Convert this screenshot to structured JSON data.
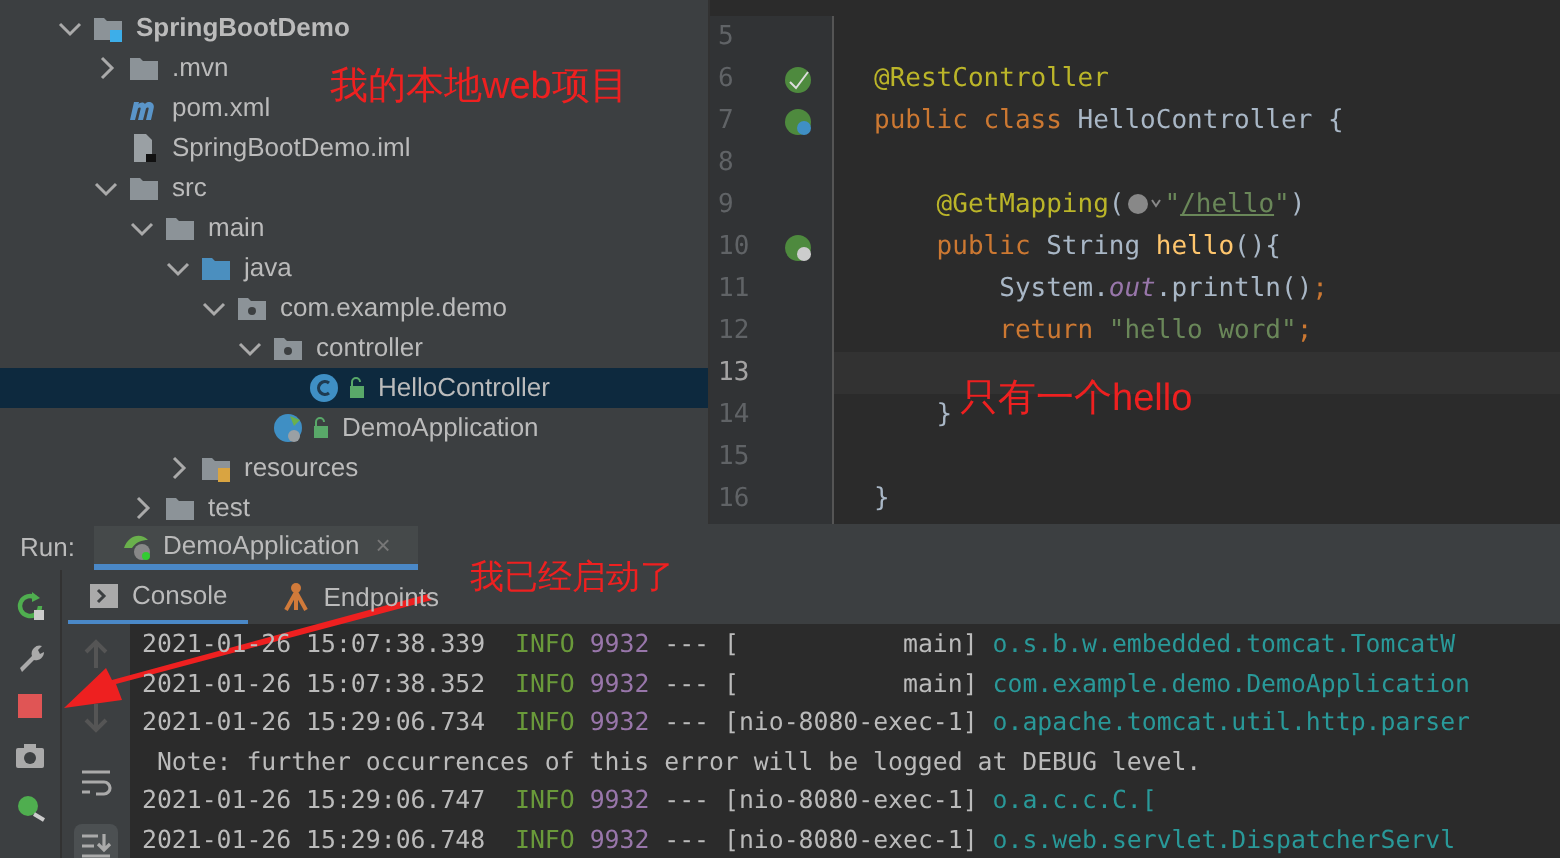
{
  "project_tree": [
    {
      "label": "SpringBootDemo",
      "kind": "module",
      "expanded": true,
      "selected": false,
      "children": [
        {
          "label": ".mvn",
          "kind": "folder",
          "expanded": false,
          "selected": false
        },
        {
          "label": "pom.xml",
          "kind": "maven",
          "selected": false
        },
        {
          "label": "SpringBootDemo.iml",
          "kind": "iml",
          "selected": false
        },
        {
          "label": "src",
          "kind": "folder",
          "expanded": true,
          "selected": false,
          "children": [
            {
              "label": "main",
              "kind": "folder",
              "expanded": true,
              "selected": false,
              "children": [
                {
                  "label": "java",
                  "kind": "source",
                  "expanded": true,
                  "selected": false,
                  "children": [
                    {
                      "label": "com.example.demo",
                      "kind": "package",
                      "expanded": true,
                      "selected": false,
                      "children": [
                        {
                          "label": "controller",
                          "kind": "package",
                          "expanded": true,
                          "selected": false,
                          "children": [
                            {
                              "label": "HelloController",
                              "kind": "class",
                              "selected": true
                            }
                          ]
                        },
                        {
                          "label": "DemoApplication",
                          "kind": "app",
                          "selected": false
                        }
                      ]
                    }
                  ]
                },
                {
                  "label": "resources",
                  "kind": "resources",
                  "expanded": false,
                  "selected": false
                }
              ]
            },
            {
              "label": "test",
              "kind": "folder",
              "expanded": false,
              "selected": false
            }
          ]
        }
      ]
    }
  ],
  "editor": {
    "lines": [
      {
        "number": "5"
      },
      {
        "number": "6",
        "kind": "bean",
        "tokens": [
          {
            "kind": "annotation",
            "text": "@RestController"
          }
        ]
      },
      {
        "number": "7",
        "kind": "class",
        "tokens": [
          {
            "kind": "keyword",
            "text": "public class "
          },
          {
            "kind": "plain",
            "text": "HelloController {"
          }
        ]
      },
      {
        "number": "8"
      },
      {
        "number": "9",
        "tokens": [
          {
            "kind": "annotation",
            "text": "    @GetMapping"
          },
          {
            "kind": "plain",
            "text": "("
          },
          {
            "kind": "web-icon"
          },
          {
            "kind": "string",
            "text": "\""
          },
          {
            "kind": "link",
            "text": "/hello"
          },
          {
            "kind": "string",
            "text": "\""
          },
          {
            "kind": "plain",
            "text": ")"
          }
        ]
      },
      {
        "number": "10",
        "kind": "mapping",
        "tokens": [
          {
            "kind": "keyword",
            "text": "    public "
          },
          {
            "kind": "plain",
            "text": "String "
          },
          {
            "kind": "method",
            "text": "hello"
          },
          {
            "kind": "plain",
            "text": "(){"
          }
        ]
      },
      {
        "number": "11",
        "tokens": [
          {
            "kind": "plain",
            "text": "        System."
          },
          {
            "kind": "field",
            "text": "out"
          },
          {
            "kind": "plain",
            "text": ".println()"
          },
          {
            "kind": "keyword",
            "text": ";"
          }
        ]
      },
      {
        "number": "12",
        "tokens": [
          {
            "kind": "keyword",
            "text": "        return "
          },
          {
            "kind": "string",
            "text": "\"hello word\""
          },
          {
            "kind": "keyword",
            "text": ";"
          }
        ]
      },
      {
        "number": "13",
        "current": true
      },
      {
        "number": "14",
        "tokens": [
          {
            "kind": "plain",
            "text": "    }"
          }
        ]
      },
      {
        "number": "15"
      },
      {
        "number": "16",
        "tokens": [
          {
            "kind": "plain",
            "text": "}"
          }
        ]
      }
    ]
  },
  "run_panel": {
    "label": "Run:",
    "tabs": [
      {
        "label": "DemoApplication",
        "close": "×",
        "selected": true
      }
    ],
    "sub_tabs": [
      {
        "label": "Console",
        "kind": "console",
        "selected": true
      },
      {
        "label": "Endpoints",
        "kind": "endpoints",
        "selected": false
      }
    ],
    "log": [
      {
        "kind": "entry",
        "timestamp": "2021-01-26 15:07:38.339",
        "level": "INFO",
        "pid": "9932",
        "sep": "---",
        "thread": "[           main]",
        "logger": "o.s.b.w.embedded.tomcat.TomcatW"
      },
      {
        "kind": "entry",
        "timestamp": "2021-01-26 15:07:38.352",
        "level": "INFO",
        "pid": "9932",
        "sep": "---",
        "thread": "[           main]",
        "logger": "com.example.demo.DemoApplication"
      },
      {
        "kind": "entry",
        "timestamp": "2021-01-26 15:29:06.734",
        "level": "INFO",
        "pid": "9932",
        "sep": "---",
        "thread": "[nio-8080-exec-1]",
        "logger": "o.apache.tomcat.util.http.parser"
      },
      {
        "kind": "note",
        "text": " Note: further occurrences of this error will be logged at DEBUG level."
      },
      {
        "kind": "entry",
        "timestamp": "2021-01-26 15:29:06.747",
        "level": "INFO",
        "pid": "9932",
        "sep": "---",
        "thread": "[nio-8080-exec-1]",
        "logger": "o.a.c.c.C.["
      },
      {
        "kind": "entry",
        "timestamp": "2021-01-26 15:29:06.748",
        "level": "INFO",
        "pid": "9932",
        "sep": "---",
        "thread": "[nio-8080-exec-1]",
        "logger": "o.s.web.servlet.DispatcherServl"
      }
    ]
  },
  "annotations": [
    {
      "kind": "project",
      "text": "我的本地web项目"
    },
    {
      "kind": "editor",
      "text": "只有一个hello"
    },
    {
      "kind": "run",
      "text": "我已经启动了"
    }
  ]
}
